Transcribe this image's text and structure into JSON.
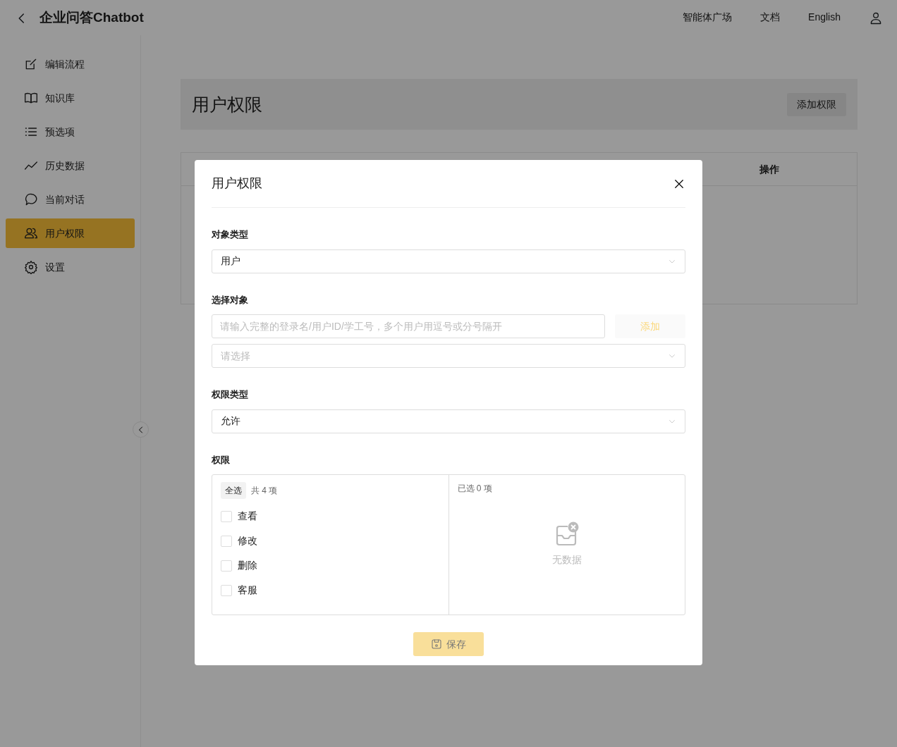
{
  "header": {
    "title": "企业问答Chatbot",
    "nav": [
      {
        "label": "智能体广场"
      },
      {
        "label": "文档"
      },
      {
        "label": "English"
      }
    ]
  },
  "sidebar": {
    "items": [
      {
        "label": "编辑流程",
        "selected": false
      },
      {
        "label": "知识库",
        "selected": false
      },
      {
        "label": "预选项",
        "selected": false
      },
      {
        "label": "历史数据",
        "selected": false
      },
      {
        "label": "当前对话",
        "selected": false
      },
      {
        "label": "用户权限",
        "selected": true
      },
      {
        "label": "设置",
        "selected": false
      }
    ]
  },
  "page": {
    "title": "用户权限",
    "add_button": "添加权限",
    "table": {
      "columns": [
        {
          "label": "操作"
        }
      ]
    }
  },
  "modal": {
    "title": "用户权限",
    "fields": [
      {
        "kind": "select",
        "label": "对象类型",
        "value": "用户"
      },
      {
        "kind": "picker",
        "label": "选择对象",
        "placeholder": "请输入完整的登录名/用户ID/学工号，多个用户用逗号或分号隔开",
        "button": {
          "label": "添加",
          "disabled": true
        },
        "select_placeholder": "请选择"
      },
      {
        "kind": "select",
        "label": "权限类型",
        "value": "允许"
      },
      {
        "kind": "transfer",
        "label": "权限",
        "select_all": "全选",
        "count": "共 4 项",
        "items": [
          {
            "label": "查看",
            "checked": false
          },
          {
            "label": "修改",
            "checked": false
          },
          {
            "label": "删除",
            "checked": false
          },
          {
            "label": "客服",
            "checked": false
          }
        ],
        "selected_count": "已选 0 项",
        "empty": "无数据"
      }
    ],
    "save": {
      "label": "保存",
      "disabled": true
    }
  }
}
